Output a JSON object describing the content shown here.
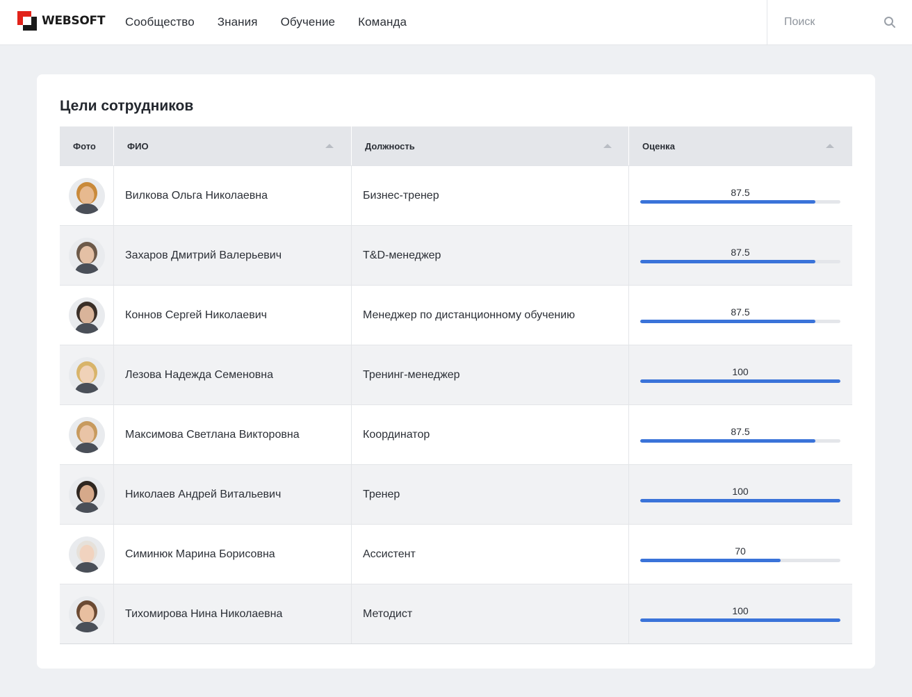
{
  "header": {
    "logo_text": "WEBSOFT",
    "nav": [
      {
        "label": "Сообщество"
      },
      {
        "label": "Знания"
      },
      {
        "label": "Обучение"
      },
      {
        "label": "Команда"
      }
    ],
    "search": {
      "placeholder": "Поиск",
      "value": "",
      "icon": "search-icon"
    }
  },
  "main": {
    "title": "Цели сотрудников",
    "columns": {
      "photo": "Фото",
      "name": "ФИО",
      "position": "Должность",
      "score": "Оценка"
    },
    "rows": [
      {
        "name": "Вилкова Ольга Николаевна",
        "position": "Бизнес-тренер",
        "score": "87.5",
        "score_fraction": 0.875
      },
      {
        "name": "Захаров Дмитрий Валерьевич",
        "position": "T&D-менеджер",
        "score": "87.5",
        "score_fraction": 0.875
      },
      {
        "name": "Коннов Сергей Николаевич",
        "position": "Менеджер по дистанционному обучению",
        "score": "87.5",
        "score_fraction": 0.875
      },
      {
        "name": "Лезова Надежда Семеновна",
        "position": "Тренинг-менеджер",
        "score": "100",
        "score_fraction": 1.0
      },
      {
        "name": "Максимова Светлана Викторовна",
        "position": "Координатор",
        "score": "87.5",
        "score_fraction": 0.875
      },
      {
        "name": "Николаев Андрей Витальевич",
        "position": "Тренер",
        "score": "100",
        "score_fraction": 1.0
      },
      {
        "name": "Симинюк Марина Борисовна",
        "position": "Ассистент",
        "score": "70",
        "score_fraction": 0.7
      },
      {
        "name": "Тихомирова Нина Николаевна",
        "position": "Методист",
        "score": "100",
        "score_fraction": 1.0
      }
    ]
  },
  "colors": {
    "accent": "#3a73d9",
    "logo_red": "#e2231a",
    "logo_dark": "#1a1a1a"
  }
}
